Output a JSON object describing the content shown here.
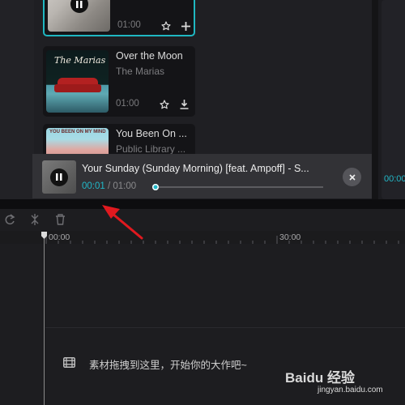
{
  "library": {
    "cards": [
      {
        "title": "",
        "artist": "",
        "duration": "01:00",
        "active": true
      },
      {
        "title": "Over the Moon",
        "artist": "The Marias",
        "duration": "01:00",
        "active": false,
        "cover_text": "The Marias"
      },
      {
        "title": "You Been On ...",
        "artist": "Public Library ...",
        "duration": "",
        "active": false,
        "cover_text": "YOU BEEN ON MY MIND"
      }
    ]
  },
  "player": {
    "title": "Your Sunday (Sunday Morning) [feat. Ampoff] - S...",
    "current_time": "00:01",
    "separator": "/",
    "total_time": "01:00",
    "progress": 0.017
  },
  "right_panel": {
    "time": "00:00"
  },
  "timeline": {
    "ticks": [
      "00:00",
      "30:00"
    ],
    "empty_hint": "素材拖拽到这里，开始你的大作吧~"
  },
  "watermark": {
    "brand": "Baidu 经验",
    "url": "jingyan.baidu.com"
  },
  "colors": {
    "accent": "#21b8c8",
    "annotation_arrow": "#e0191f"
  }
}
